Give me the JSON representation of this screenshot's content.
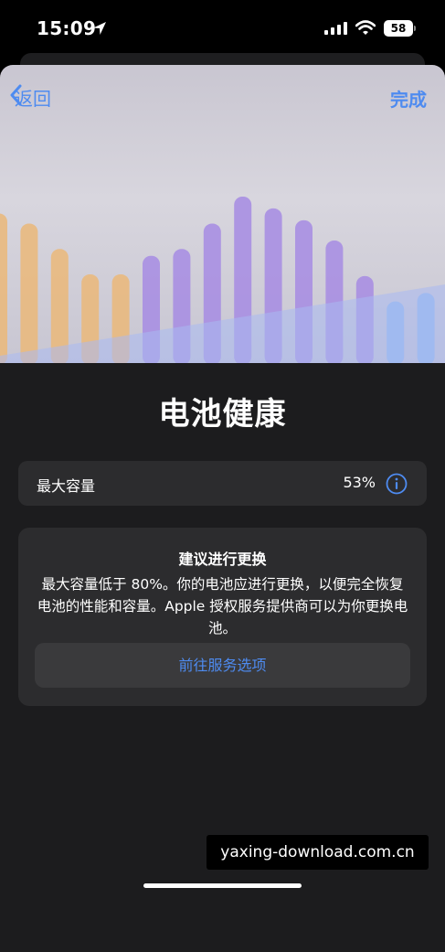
{
  "status_bar": {
    "time": "15:09",
    "battery_level": "58",
    "icons": [
      "location-arrow-icon",
      "cellular-signal-icon",
      "wifi-icon",
      "battery-icon"
    ]
  },
  "nav": {
    "back_label": "返回",
    "done_label": "完成",
    "accent_color": "#4e8bf0"
  },
  "hero": {
    "bars": [
      {
        "level": 0.83,
        "color": "#e9b97e"
      },
      {
        "level": 0.77,
        "color": "#e9b97e"
      },
      {
        "level": 0.62,
        "color": "#e9b97e"
      },
      {
        "level": 0.47,
        "color": "#e9b97e"
      },
      {
        "level": 0.47,
        "color": "#e9b97e"
      },
      {
        "level": 0.58,
        "color": "#a98fe2"
      },
      {
        "level": 0.62,
        "color": "#a98fe2"
      },
      {
        "level": 0.77,
        "color": "#a98fe2"
      },
      {
        "level": 0.93,
        "color": "#a98fe2"
      },
      {
        "level": 0.86,
        "color": "#a98fe2"
      },
      {
        "level": 0.79,
        "color": "#a98fe2"
      },
      {
        "level": 0.67,
        "color": "#a98fe2"
      },
      {
        "level": 0.46,
        "color": "#a98fe2"
      },
      {
        "level": 0.31,
        "color": "#8fb8ef"
      },
      {
        "level": 0.36,
        "color": "#8fb8ef"
      }
    ]
  },
  "page": {
    "title": "电池健康"
  },
  "capacity": {
    "label": "最大容量",
    "value": "53%"
  },
  "advice": {
    "title": "建议进行更换",
    "body": "最大容量低于 80%。你的电池应进行更换，以便完全恢复电池的性能和容量。Apple 授权服务提供商可以为你更换电池。",
    "button_label": "前往服务选项"
  },
  "watermark": "yaxing-download.com.cn"
}
